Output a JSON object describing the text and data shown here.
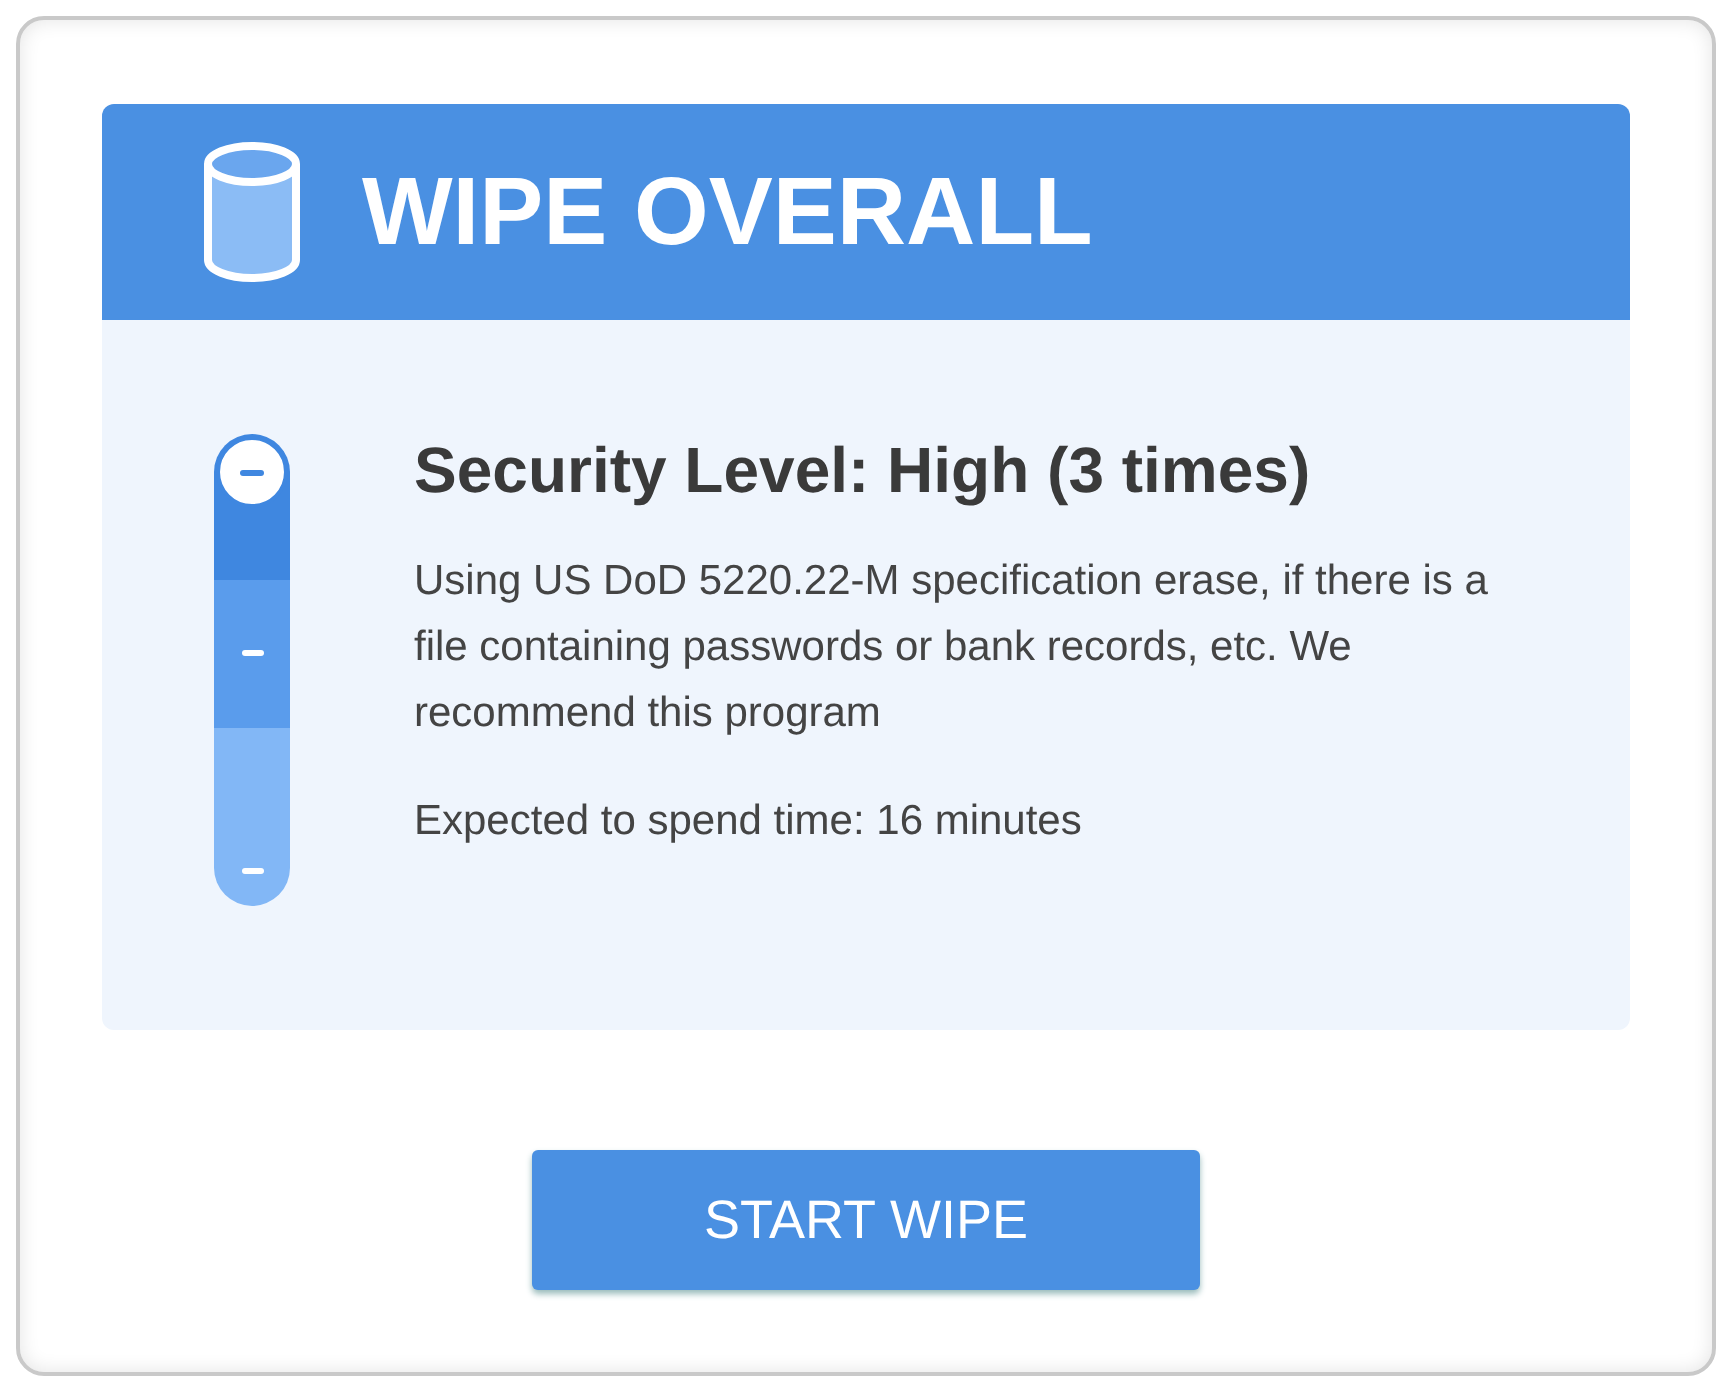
{
  "header": {
    "title": "WIPE OVERALL"
  },
  "security_levels": [
    {
      "selected": true
    },
    {
      "selected": false
    },
    {
      "selected": false
    }
  ],
  "details": {
    "title": "Security Level: High (3 times)",
    "description": "Using US DoD 5220.22-M specification erase, if there is a file containing passwords or bank records, etc. We recommend this program",
    "estimate": "Expected to spend time: 16 minutes"
  },
  "start_button": {
    "label": "START WIPE"
  }
}
